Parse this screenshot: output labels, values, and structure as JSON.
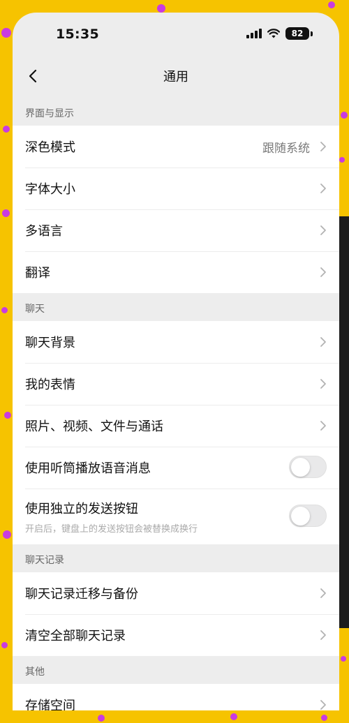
{
  "status_bar": {
    "time": "15:35",
    "battery": "82"
  },
  "nav": {
    "title": "通用"
  },
  "sections": {
    "display": {
      "header": "界面与显示",
      "items": [
        {
          "label": "深色模式",
          "value": "跟随系统"
        },
        {
          "label": "字体大小"
        },
        {
          "label": "多语言"
        },
        {
          "label": "翻译"
        }
      ]
    },
    "chat": {
      "header": "聊天",
      "items": [
        {
          "label": "聊天背景"
        },
        {
          "label": "我的表情"
        },
        {
          "label": "照片、视频、文件与通话"
        },
        {
          "label": "使用听筒播放语音消息",
          "toggle": false
        },
        {
          "label": "使用独立的发送按钮",
          "sub": "开启后，键盘上的发送按钮会被替换成换行",
          "toggle": false
        }
      ]
    },
    "records": {
      "header": "聊天记录",
      "items": [
        {
          "label": "聊天记录迁移与备份"
        },
        {
          "label": "清空全部聊天记录"
        }
      ]
    },
    "other": {
      "header": "其他",
      "items": [
        {
          "label": "存储空间"
        }
      ]
    }
  },
  "colors": {
    "background": "#F6C300",
    "dots": "#C93BE0",
    "panel": "#EDEDED"
  }
}
